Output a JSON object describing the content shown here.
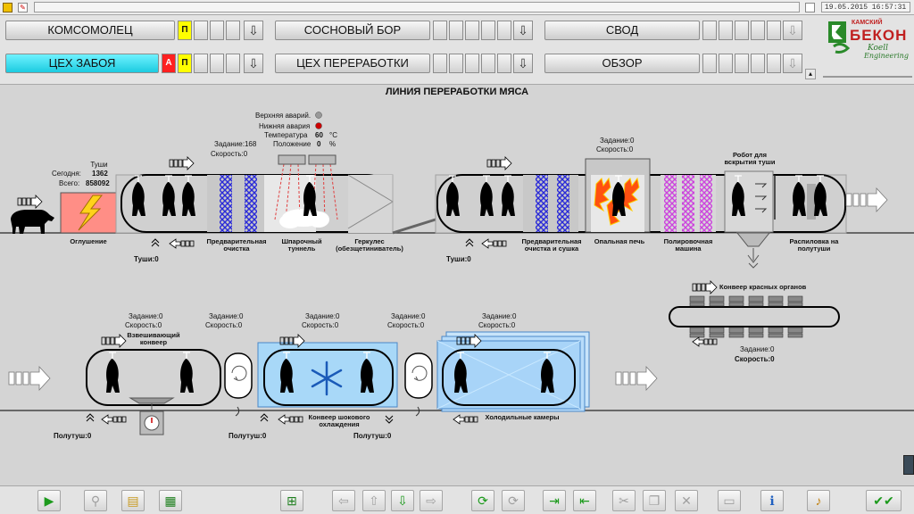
{
  "titlebar": {
    "datetime": "19.05.2015 16:57:31"
  },
  "nav": {
    "row1": [
      "КОМСОМОЛЕЦ",
      "СОСНОВЫЙ БОР",
      "СВОД"
    ],
    "row2": [
      "ЦЕХ ЗАБОЯ",
      "ЦЕХ ПЕРЕРАБОТКИ",
      "ОБЗОР"
    ],
    "ind_p": "П",
    "ind_a": "А"
  },
  "logo": {
    "line1": "КАМСКИЙ",
    "line2": "БЕКОН",
    "line3": "Koell",
    "line4": "Engineering"
  },
  "page": {
    "title": "ЛИНИЯ ПЕРЕРАБОТКИ МЯСА"
  },
  "stun": {
    "heading": "Туши",
    "today_label": "Сегодня:",
    "today_value": "1362",
    "total_label": "Всего:",
    "total_value": "858092",
    "name": "Оглушение",
    "carcass_label": "Туши:0"
  },
  "scald_params": {
    "upper_alarm": "Верхняя аварий.",
    "lower_alarm": "Нижняя авария",
    "temp_label": "Температура",
    "temp_value": "60",
    "temp_unit": "°C",
    "pos_label": "Положение",
    "pos_value": "0",
    "pos_unit": "%",
    "task": "Задание:168",
    "speed": "Скорость:0"
  },
  "stages_top": {
    "prewash": "Предварительная очистка",
    "scald": "Шпарочный туннель",
    "hercules": "Геркулес (обезщетиниватель)",
    "prewash_dry": "Предварительная очистка и сушка",
    "singe": "Опальная печь",
    "polish": "Полировочная машина",
    "robot": "Робот для вскрытия туши",
    "split": "Распиловка на полутуши",
    "task": "Задание:0",
    "speed": "Скорость:0",
    "carcass2": "Туши:0"
  },
  "red_organs": {
    "name": "Конвеер красных органов",
    "task": "Задание:0",
    "speed": "Скорость:0"
  },
  "bottom_line": {
    "weigh": "Взвешивающий конвеер",
    "shock": "Конвеер шокового охлаждения",
    "cold": "Холодильные камеры",
    "task": "Задание:0",
    "speed": "Скорость:0",
    "halves": "Полутуш:0"
  },
  "colors": {
    "accent_cyan": "#1ccbe0",
    "alarm_red": "#cc0000",
    "cool_blue": "#a8d8f8"
  }
}
